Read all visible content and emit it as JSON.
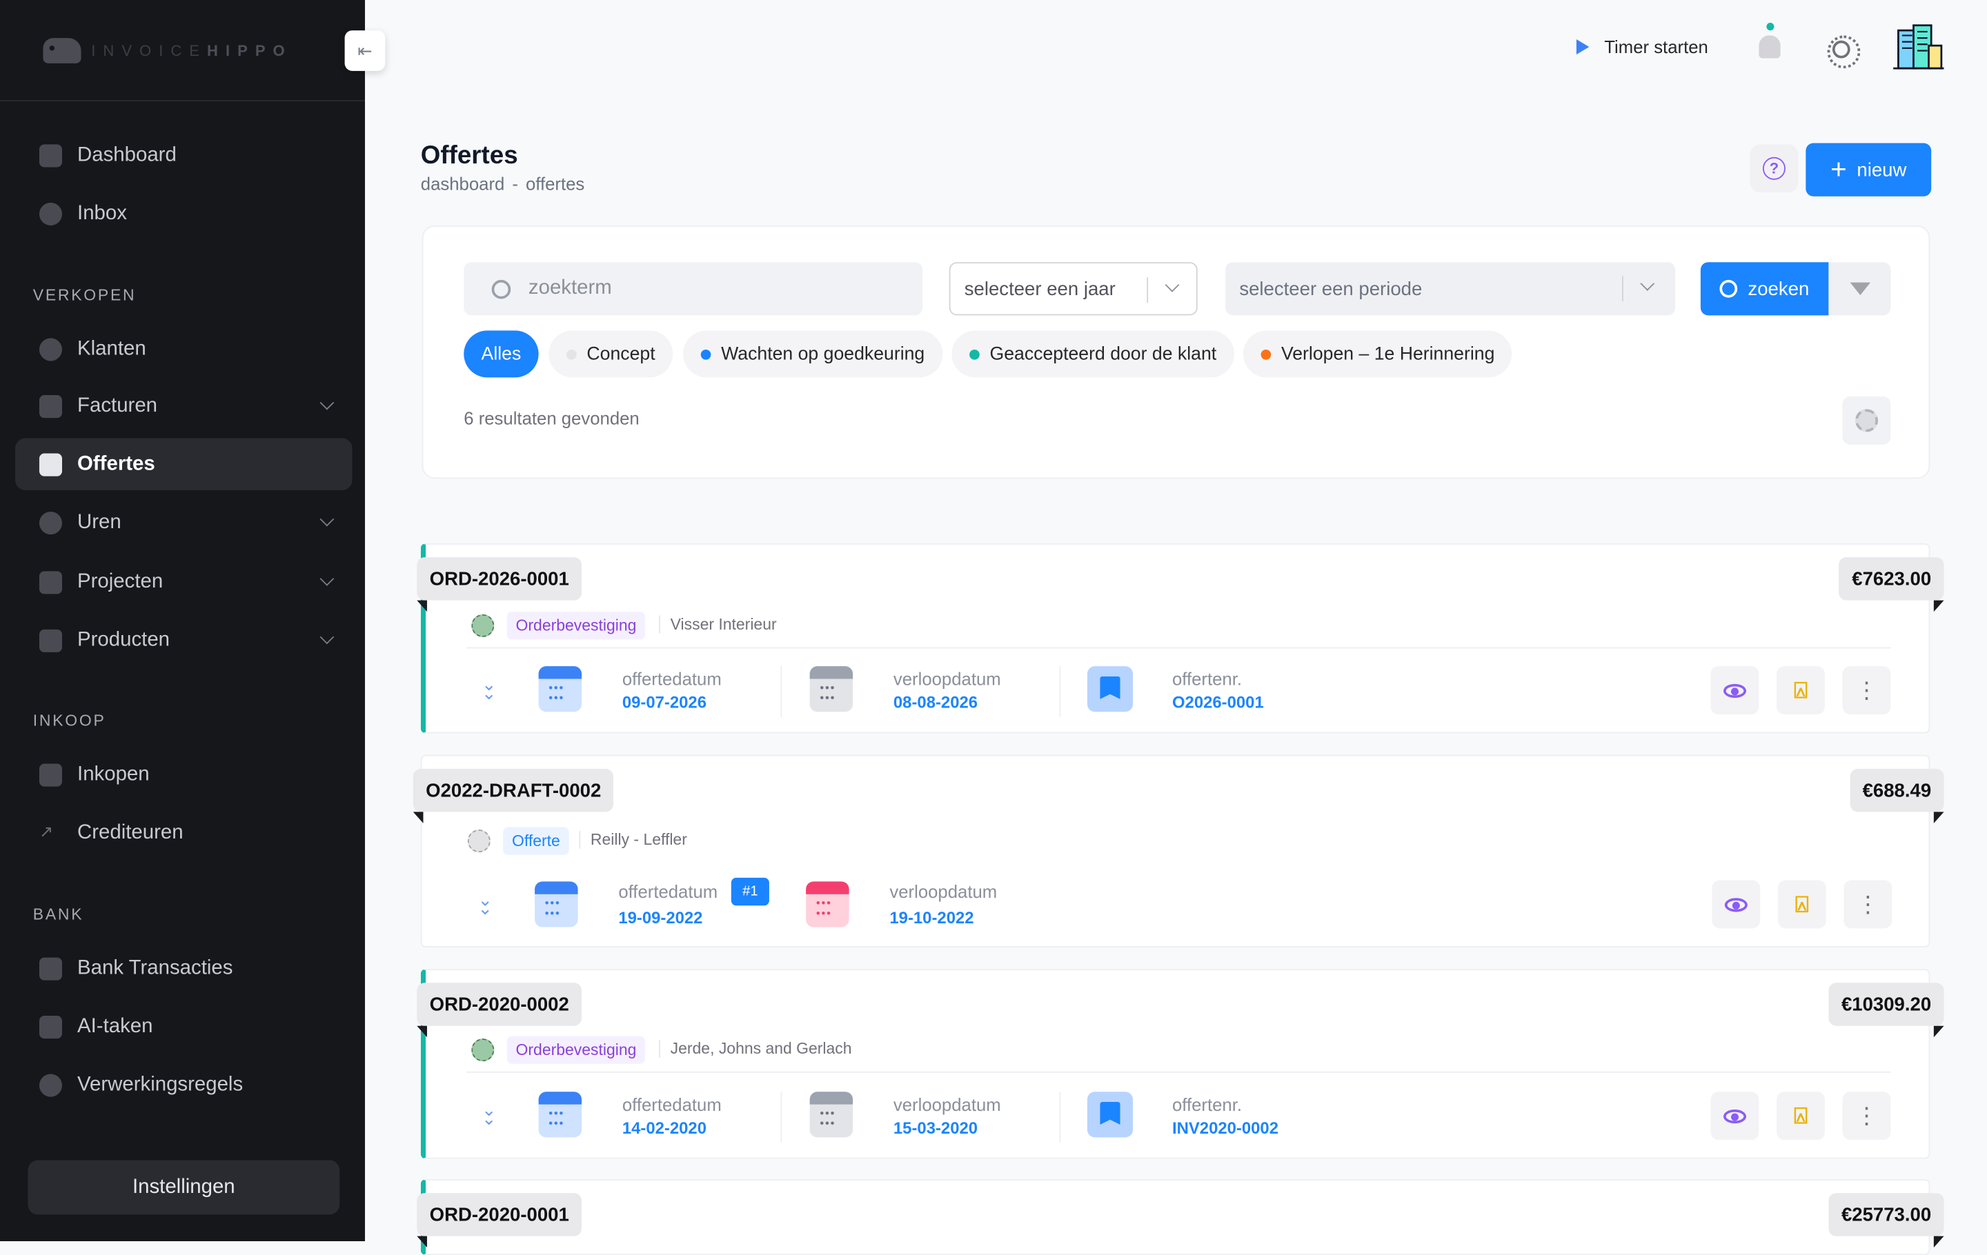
{
  "brand": {
    "logo_light": "INVOICE",
    "logo_bold": "HIPPO"
  },
  "sidebar": {
    "collapse_icon": "arrow-left-bar-icon",
    "top_items": [
      {
        "label": "Dashboard",
        "icon": "grid-icon"
      },
      {
        "label": "Inbox",
        "icon": "inbox-hand-icon"
      }
    ],
    "sections": [
      {
        "title": "VERKOPEN",
        "items": [
          {
            "label": "Klanten",
            "icon": "users-icon"
          },
          {
            "label": "Facturen",
            "icon": "invoice-icon",
            "expandable": true
          },
          {
            "label": "Offertes",
            "icon": "quote-doc-icon",
            "active": true
          },
          {
            "label": "Uren",
            "icon": "clock-icon",
            "expandable": true
          },
          {
            "label": "Projecten",
            "icon": "briefcase-icon",
            "expandable": true
          },
          {
            "label": "Producten",
            "icon": "lock-icon",
            "expandable": true
          }
        ]
      },
      {
        "title": "INKOOP",
        "items": [
          {
            "label": "Inkopen",
            "icon": "basket-icon"
          },
          {
            "label": "Crediteuren",
            "icon": "arrow-up-right-icon"
          }
        ]
      },
      {
        "title": "BANK",
        "items": [
          {
            "label": "Bank Transacties",
            "icon": "bank-icon"
          },
          {
            "label": "AI-taken",
            "icon": "layers-icon"
          },
          {
            "label": "Verwerkingsregels",
            "icon": "gear-icon"
          }
        ]
      }
    ],
    "settings_label": "Instellingen"
  },
  "topbar": {
    "timer_label": "Timer starten"
  },
  "page": {
    "title": "Offertes",
    "breadcrumb": [
      "dashboard",
      "offertes"
    ],
    "new_label": "nieuw"
  },
  "filters": {
    "search_placeholder": "zoekterm",
    "year_placeholder": "selecteer een jaar",
    "period_placeholder": "selecteer een periode",
    "search_label": "zoeken",
    "pills": [
      {
        "label": "Alles",
        "active": true
      },
      {
        "label": "Concept",
        "dot": "#e4e4e7"
      },
      {
        "label": "Wachten op goedkeuring",
        "dot": "#1b84ff"
      },
      {
        "label": "Geaccepteerd door de klant",
        "dot": "#14b8a6"
      },
      {
        "label": "Verlopen – 1e Herinnering",
        "dot": "#f97316"
      }
    ],
    "results_text": "6 resultaten gevonden"
  },
  "labels": {
    "offer_date": "offertedatum",
    "expiry_date": "verloopdatum",
    "offer_number": "offertenr."
  },
  "quotes": [
    {
      "number": "ORD-2026-0001",
      "amount": "€7623.00",
      "type": "Orderbevestiging",
      "client": "Visser Interieur",
      "offer_date": "09-07-2026",
      "expiry_date": "08-08-2026",
      "offer_number": "O2026-0001"
    },
    {
      "number": "O2022-DRAFT-0002",
      "amount": "€688.49",
      "type": "Offerte",
      "client": "Reilly - Leffler",
      "offer_date": "19-09-2022",
      "expiry_date": "19-10-2022",
      "version_badge": "⁠#1"
    },
    {
      "number": "ORD-2020-0002",
      "amount": "€10309.20",
      "type": "Orderbevestiging",
      "client": "Jerde, Johns and Gerlach",
      "offer_date": "14-02-2020",
      "expiry_date": "15-03-2020",
      "offer_number": "INV2020-0002"
    },
    {
      "number": "ORD-2020-0001",
      "amount": "€25773.00"
    }
  ]
}
